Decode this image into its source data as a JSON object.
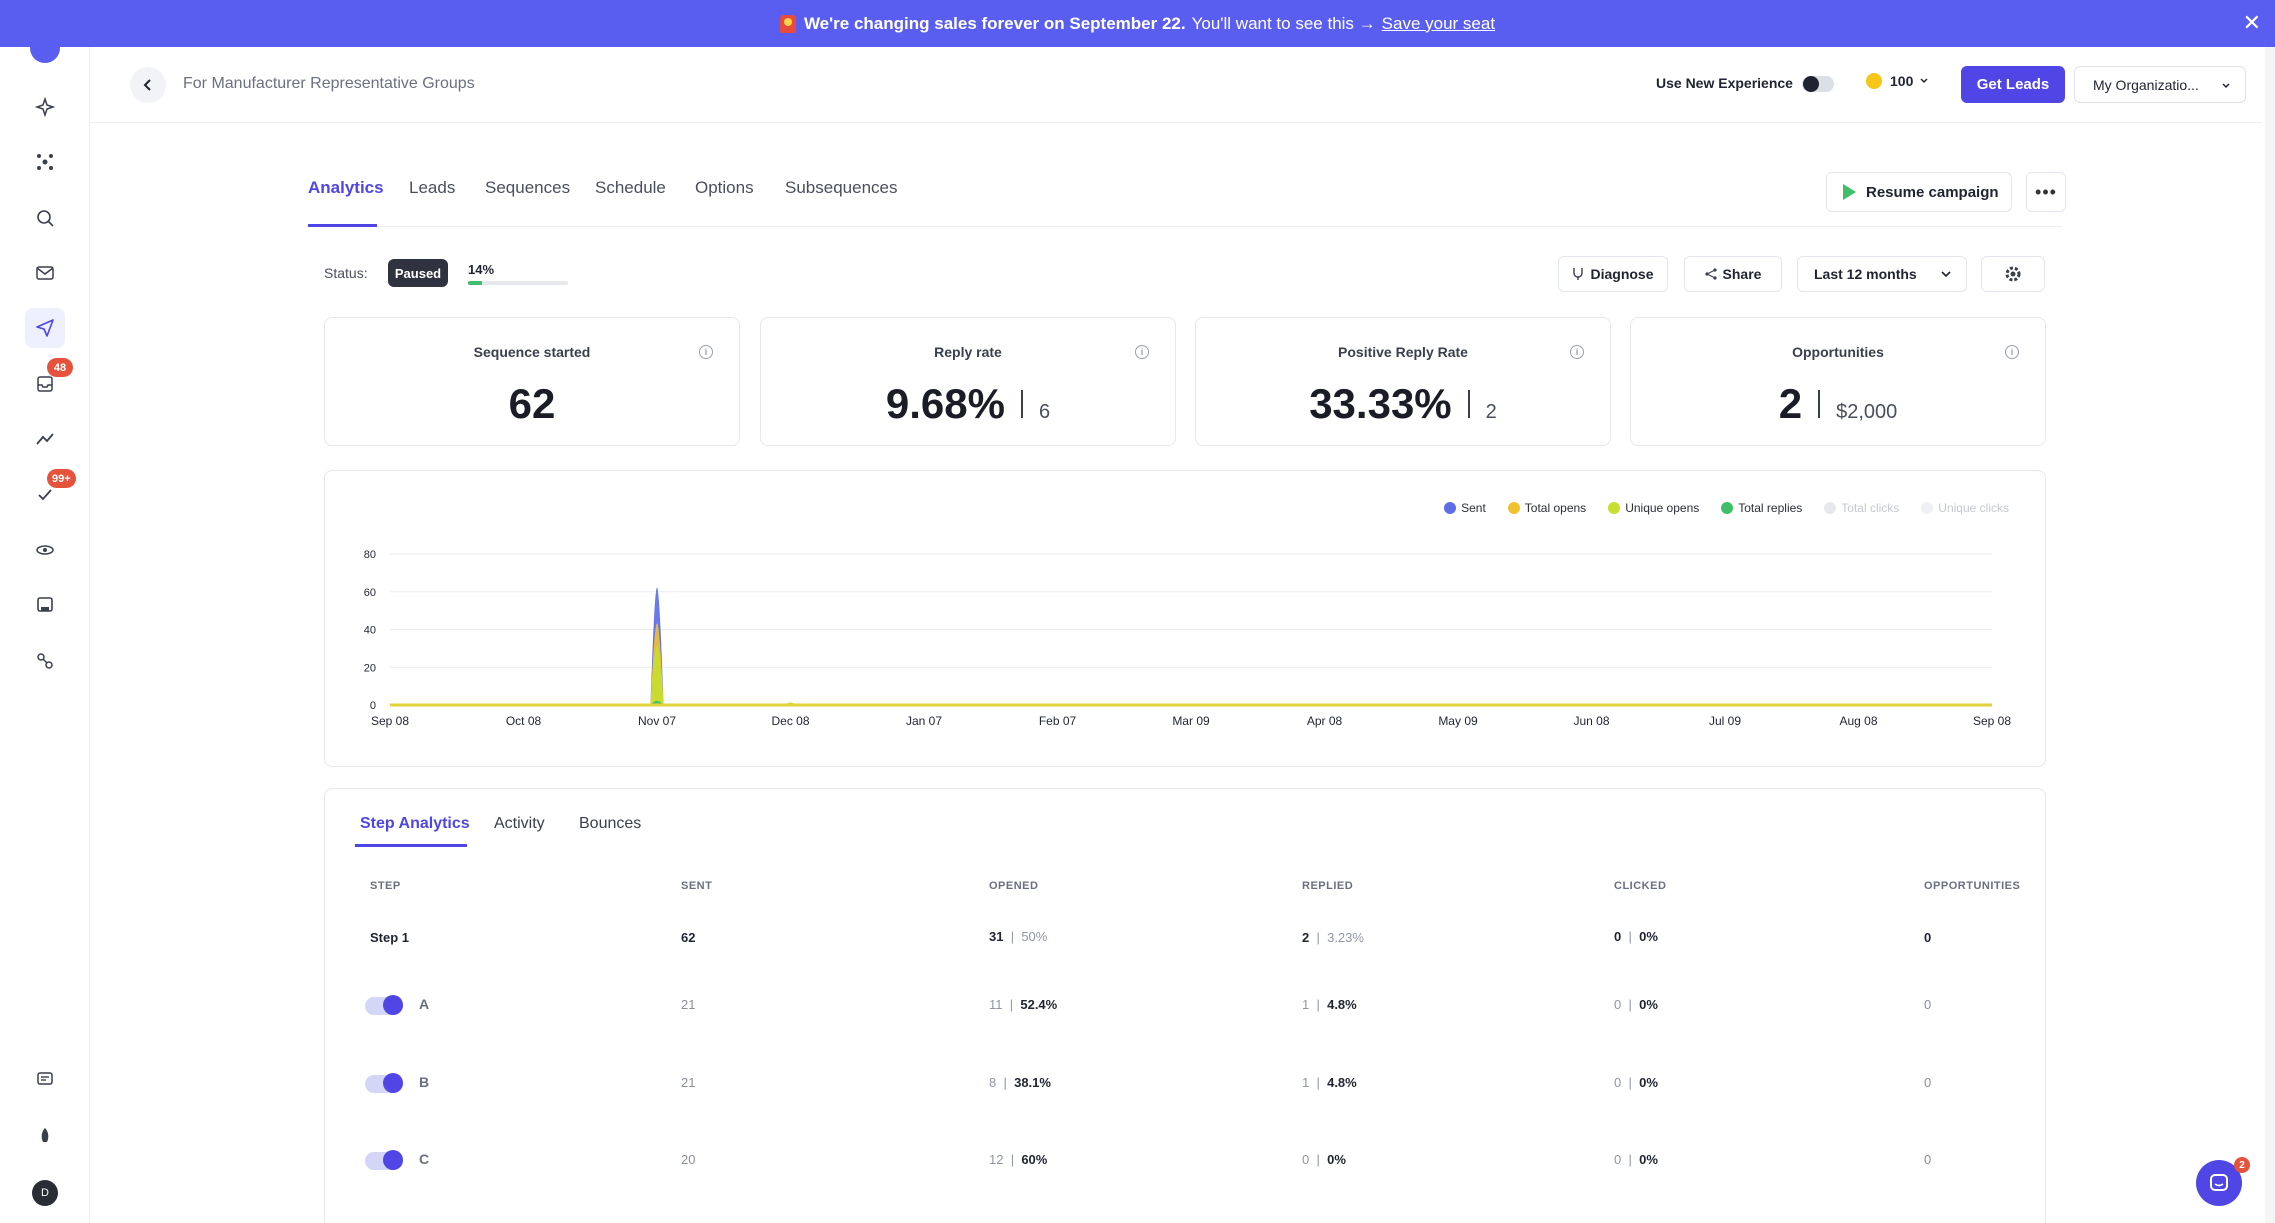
{
  "banner": {
    "headline": "We're changing sales forever on September 22.",
    "subtext": "You'll want to see this →",
    "link": "Save your seat"
  },
  "sidebar": {
    "badge_1": "48",
    "badge_2": "99+",
    "avatar_initial": "D"
  },
  "header": {
    "breadcrumb": "For Manufacturer Representative Groups",
    "new_experience_label": "Use New Experience",
    "credits": "100",
    "get_leads_label": "Get Leads",
    "org_label": "My Organizatio..."
  },
  "tabs": [
    "Analytics",
    "Leads",
    "Sequences",
    "Schedule",
    "Options",
    "Subsequences"
  ],
  "actions": {
    "resume_label": "Resume campaign",
    "diagnose_label": "Diagnose",
    "share_label": "Share",
    "range_label": "Last 12 months"
  },
  "status": {
    "label": "Status:",
    "value": "Paused",
    "progress_label": "14%",
    "progress_value": 14
  },
  "cards": [
    {
      "label": "Sequence started",
      "value": "62",
      "sub": ""
    },
    {
      "label": "Reply rate",
      "value": "9.68%",
      "sub": "6"
    },
    {
      "label": "Positive Reply Rate",
      "value": "33.33%",
      "sub": "2"
    },
    {
      "label": "Opportunities",
      "value": "2",
      "sub": "$2,000"
    }
  ],
  "chart_data": {
    "type": "area",
    "x": [
      "Sep 08",
      "Oct 08",
      "Nov 07",
      "Dec 08",
      "Jan 07",
      "Feb 07",
      "Mar 09",
      "Apr 08",
      "May 09",
      "Jun 08",
      "Jul 09",
      "Aug 08",
      "Sep 08"
    ],
    "ylim": [
      0,
      80
    ],
    "yticks": [
      0,
      20,
      40,
      60,
      80
    ],
    "legend_position": "top-right",
    "grid": true,
    "series": [
      {
        "name": "Sent",
        "color": "#5b6ee8",
        "values": [
          0,
          0,
          62,
          0,
          0,
          0,
          0,
          0,
          0,
          0,
          0,
          0,
          0
        ]
      },
      {
        "name": "Total opens",
        "color": "#f2c12e",
        "values": [
          0,
          0,
          43,
          1,
          0,
          0,
          0,
          0,
          0,
          0,
          0,
          0,
          0
        ]
      },
      {
        "name": "Unique opens",
        "color": "#c7df2e",
        "values": [
          0,
          0,
          31,
          1,
          0,
          0,
          0,
          0,
          0,
          0,
          0,
          0,
          0
        ]
      },
      {
        "name": "Total replies",
        "color": "#3fbf6a",
        "values": [
          0,
          0,
          2,
          0,
          0,
          0,
          0,
          0,
          0,
          0,
          0,
          0,
          0
        ]
      },
      {
        "name": "Total clicks",
        "color": "#e6e8ee",
        "values": [
          0,
          0,
          0,
          0,
          0,
          0,
          0,
          0,
          0,
          0,
          0,
          0,
          0
        ]
      },
      {
        "name": "Unique clicks",
        "color": "#eef0f4",
        "values": [
          0,
          0,
          0,
          0,
          0,
          0,
          0,
          0,
          0,
          0,
          0,
          0,
          0
        ]
      }
    ]
  },
  "steps": {
    "tabs": [
      "Step Analytics",
      "Activity",
      "Bounces"
    ],
    "headers": [
      "STEP",
      "SENT",
      "OPENED",
      "REPLIED",
      "CLICKED",
      "OPPORTUNITIES"
    ],
    "rows": [
      {
        "step": "Step 1",
        "sent": "62",
        "opened": "31",
        "opened_pct": "50%",
        "replied": "2",
        "replied_pct": "3.23%",
        "clicked": "0",
        "clicked_pct": "0%",
        "opps": "0"
      },
      {
        "step": "A",
        "sent": "21",
        "opened": "11",
        "opened_pct": "52.4%",
        "replied": "1",
        "replied_pct": "4.8%",
        "clicked": "0",
        "clicked_pct": "0%",
        "opps": "0"
      },
      {
        "step": "B",
        "sent": "21",
        "opened": "8",
        "opened_pct": "38.1%",
        "replied": "1",
        "replied_pct": "4.8%",
        "clicked": "0",
        "clicked_pct": "0%",
        "opps": "0"
      },
      {
        "step": "C",
        "sent": "20",
        "opened": "12",
        "opened_pct": "60%",
        "replied": "0",
        "replied_pct": "0%",
        "clicked": "0",
        "clicked_pct": "0%",
        "opps": "0"
      }
    ]
  },
  "chat": {
    "badge": "2"
  }
}
